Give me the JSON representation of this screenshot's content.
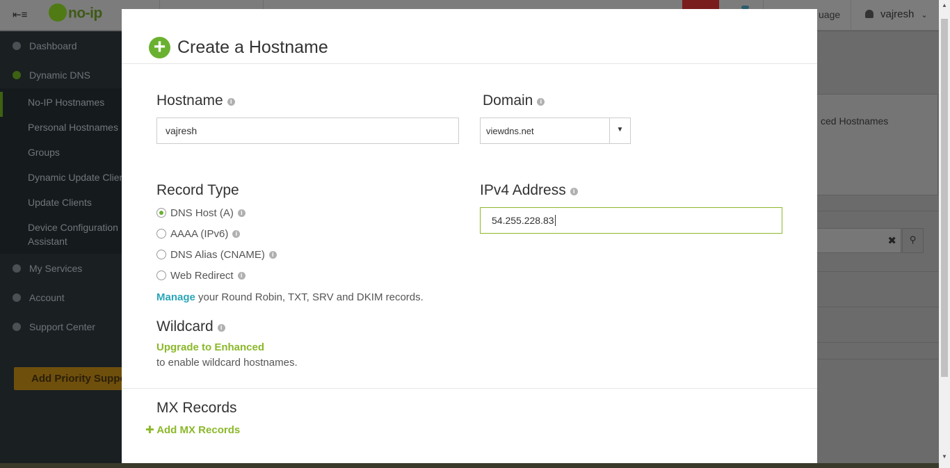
{
  "topbar": {
    "logo_text": "no-ip",
    "language_partial": "uage",
    "username": "vajresh"
  },
  "sidebar": {
    "items": [
      {
        "label": "Dashboard"
      },
      {
        "label": "Dynamic DNS"
      },
      {
        "label": "My Services"
      },
      {
        "label": "Account"
      },
      {
        "label": "Support Center"
      }
    ],
    "sub_items": [
      {
        "label": "No-IP Hostnames"
      },
      {
        "label": "Personal Hostnames"
      },
      {
        "label": "Groups"
      },
      {
        "label": "Dynamic Update Client"
      },
      {
        "label": "Update Clients"
      },
      {
        "label": "Device Configuration"
      },
      {
        "label": "Assistant"
      }
    ],
    "priority_button": "Add Priority Support"
  },
  "background": {
    "panel_text": "ced Hostnames"
  },
  "modal": {
    "title": "Create a Hostname",
    "hostname": {
      "label": "Hostname",
      "value": "vajresh"
    },
    "domain": {
      "label": "Domain",
      "value": "viewdns.net"
    },
    "record_type": {
      "label": "Record Type",
      "options": [
        {
          "label": "DNS Host (A)",
          "checked": true
        },
        {
          "label": "AAAA (IPv6)",
          "checked": false
        },
        {
          "label": "DNS Alias (CNAME)",
          "checked": false
        },
        {
          "label": "Web Redirect",
          "checked": false
        }
      ]
    },
    "ipv4": {
      "label": "IPv4 Address",
      "value": "54.255.228.83"
    },
    "manage": {
      "link": "Manage",
      "text": " your Round Robin, TXT, SRV and DKIM records."
    },
    "wildcard": {
      "label": "Wildcard",
      "upgrade_link": "Upgrade to Enhanced",
      "description": "to enable wildcard hostnames."
    },
    "mx": {
      "label": "MX Records",
      "add_link": "Add MX Records"
    }
  },
  "colors": {
    "accent_green": "#6ab130",
    "link_green": "#8bb82a",
    "link_teal": "#2ba6b8"
  }
}
